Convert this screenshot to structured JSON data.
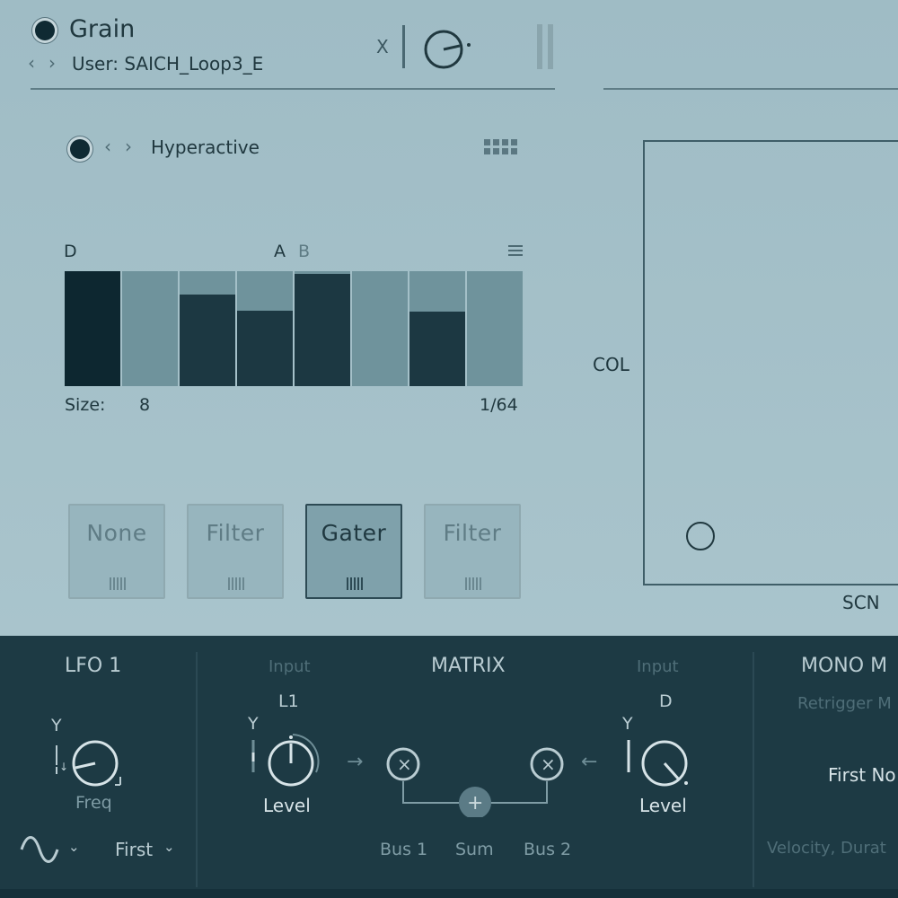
{
  "header": {
    "module_name": "Grain",
    "preset_label": "User: SAICH_Loop3_E",
    "x_label": "X"
  },
  "sequencer": {
    "preset_name": "Hyperactive",
    "marker_d": "D",
    "marker_a": "A",
    "marker_b": "B",
    "size_label": "Size:",
    "size_value": "8",
    "rate_value": "1/64",
    "steps": [
      1.0,
      0.0,
      0.8,
      0.66,
      0.98,
      0.0,
      0.65,
      0.0
    ]
  },
  "modules": [
    {
      "label": "None",
      "active": false
    },
    {
      "label": "Filter",
      "active": false
    },
    {
      "label": "Gater",
      "active": true
    },
    {
      "label": "Filter",
      "active": false
    }
  ],
  "xy_pad": {
    "y_axis_label": "COL",
    "x_axis_label": "SCN"
  },
  "lfo": {
    "title": "LFO 1",
    "y_label": "Y",
    "knob_label": "Freq",
    "retrigger_value": "First"
  },
  "matrix": {
    "title": "MATRIX",
    "input_left_label": "Input",
    "input_right_label": "Input",
    "left_source": "L1",
    "right_source": "D",
    "left_y_label": "Y",
    "right_y_label": "Y",
    "left_knob_label": "Level",
    "right_knob_label": "Level",
    "bus1_label": "Bus 1",
    "sum_label": "Sum",
    "bus2_label": "Bus 2"
  },
  "mono": {
    "title": "MONO M",
    "retrigger_label": "Retrigger M",
    "first_note_value": "First No",
    "velocity_label": "Velocity, Durat"
  },
  "colors": {
    "top_panel_bg": "#a5c1c9",
    "bottom_panel_bg": "#1d3a44",
    "step_fill": "#1c3842",
    "step_fill_dark": "#0d2730",
    "step_empty": "#6f939c",
    "active_module_bg": "#7fa1ab"
  }
}
